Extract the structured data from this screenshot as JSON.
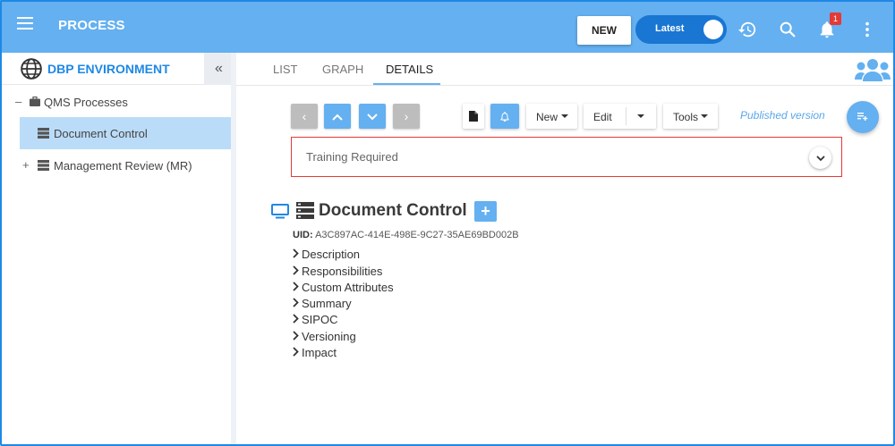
{
  "header": {
    "title": "PROCESS",
    "new_label": "NEW",
    "toggle_label": "Latest",
    "notification_count": "1"
  },
  "sidebar": {
    "env_title": "DBP ENVIRONMENT",
    "collapse_glyph": "«",
    "items": [
      {
        "label": "QMS Processes",
        "expander": "–",
        "icon": "briefcase-icon"
      },
      {
        "label": "Document Control",
        "expander": "",
        "icon": "server-stack-icon",
        "selected": true
      },
      {
        "label": "Management Review (MR)",
        "expander": "+",
        "icon": "server-stack-icon"
      }
    ]
  },
  "tabs": [
    {
      "label": "LIST"
    },
    {
      "label": "GRAPH"
    },
    {
      "label": "DETAILS",
      "active": true
    }
  ],
  "toolbar": {
    "nav": [
      "‹",
      "⌃",
      "⌄",
      "›"
    ],
    "new_label": "New",
    "edit_label": "Edit",
    "tools_label": "Tools",
    "status": "Published version"
  },
  "training": {
    "label": "Training Required"
  },
  "details": {
    "title": "Document Control",
    "plus": "+",
    "uid_label": "UID:",
    "uid_value": "A3C897AC-414E-498E-9C27-35AE69BD002B",
    "sections": [
      "Description",
      "Responsibilities",
      "Custom Attributes",
      "Summary",
      "SIPOC",
      "Versioning",
      "Impact"
    ]
  },
  "colors": {
    "topbar": "#64b0f0",
    "accent": "#1e88e5",
    "selected_row": "#bbdcf8",
    "error_border": "#e53935"
  }
}
